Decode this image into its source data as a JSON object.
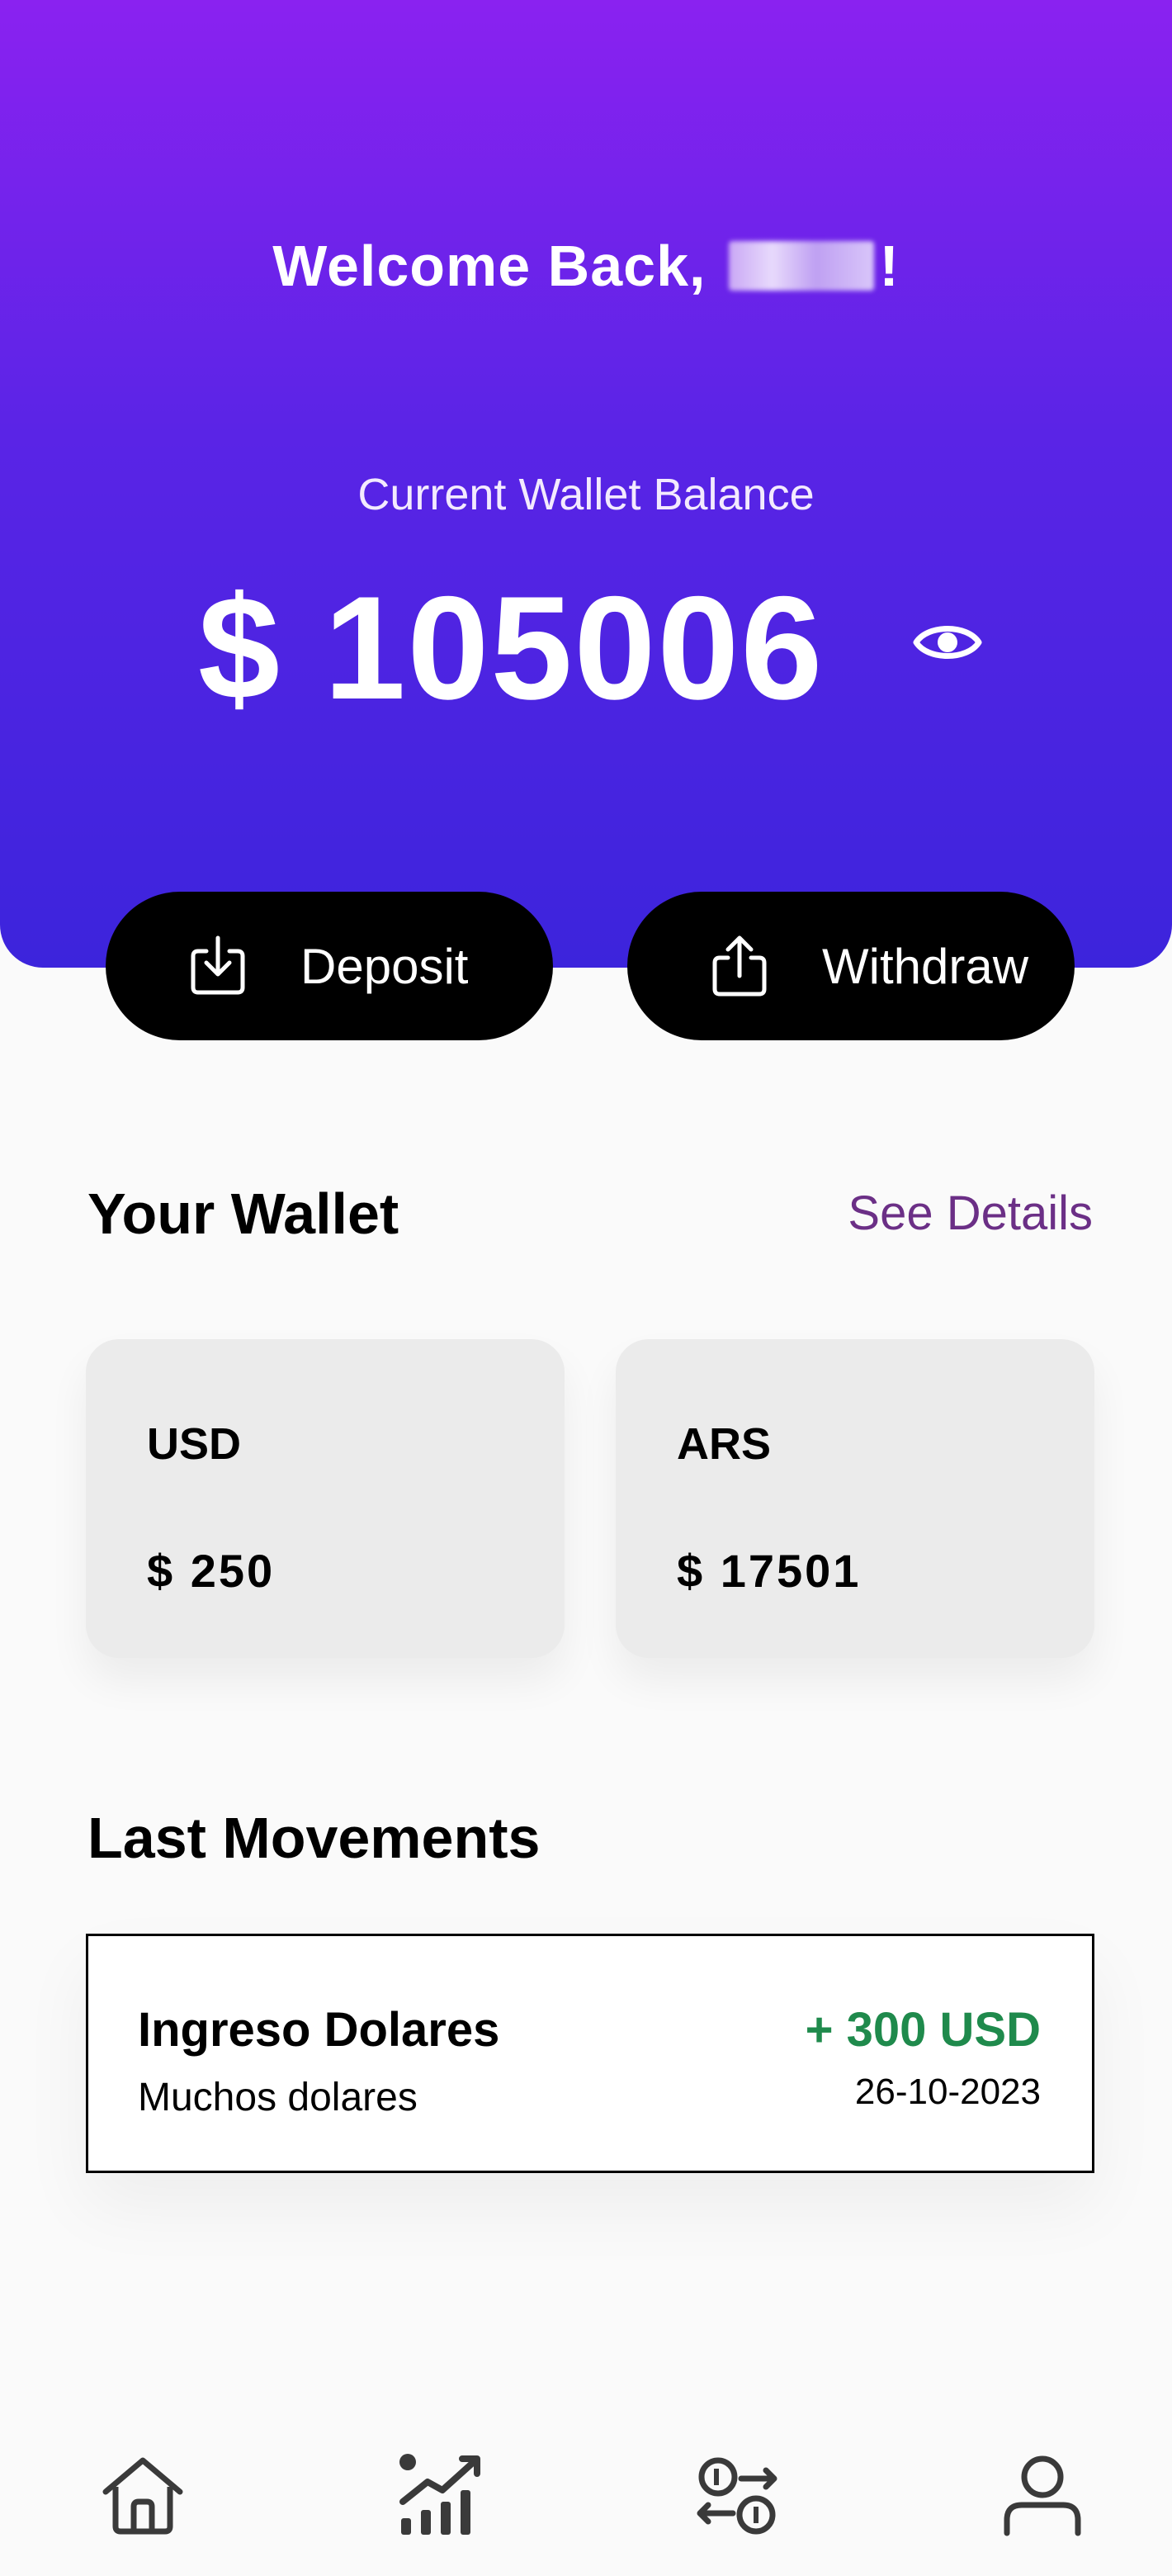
{
  "header": {
    "welcome_text": "Welcome Back,",
    "welcome_suffix": "!",
    "balance_label": "Current Wallet Balance",
    "balance_amount": "$ 105006",
    "toggle_icon": "eye-icon"
  },
  "actions": {
    "deposit_label": "Deposit",
    "deposit_icon": "download-icon",
    "withdraw_label": "Withdraw",
    "withdraw_icon": "upload-icon"
  },
  "wallet": {
    "title": "Your Wallet",
    "see_details": "See Details",
    "cards": [
      {
        "currency": "USD",
        "amount": "$ 250"
      },
      {
        "currency": "ARS",
        "amount": "$ 17501"
      }
    ]
  },
  "movements": {
    "title": "Last Movements",
    "items": [
      {
        "title": "Ingreso Dolares",
        "description": "Muchos dolares",
        "amount": "+ 300 USD",
        "date": "26-10-2023"
      }
    ]
  },
  "nav": {
    "items": [
      {
        "icon": "home-icon"
      },
      {
        "icon": "chart-icon"
      },
      {
        "icon": "exchange-icon"
      },
      {
        "icon": "profile-icon"
      }
    ]
  },
  "colors": {
    "gradient_top": "#8a22f0",
    "gradient_bottom": "#3c24dc",
    "accent_link": "#6b2f86",
    "positive": "#1f8a4c"
  }
}
